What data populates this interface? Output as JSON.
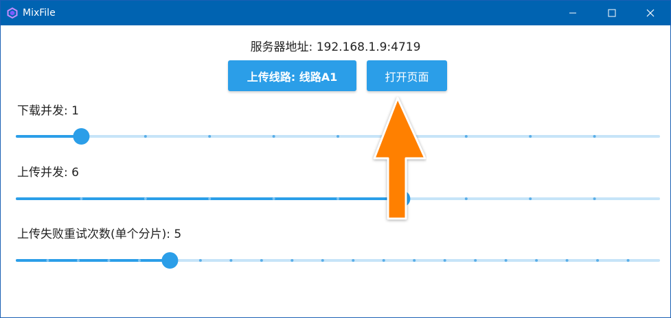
{
  "window": {
    "title": "MixFile",
    "buttons": [
      "minimize",
      "maximize",
      "close"
    ]
  },
  "server": {
    "label": "服务器地址: 192.168.1.9:4719"
  },
  "buttons": {
    "upload_line": "上传线路: 线路A1",
    "open_page": "打开页面"
  },
  "sliders": [
    {
      "label": "下载并发: 1",
      "value": 1,
      "min": 0,
      "max": 10
    },
    {
      "label": "上传并发: 6",
      "value": 6,
      "min": 0,
      "max": 10
    },
    {
      "label": "上传失败重试次数(单个分片): 5",
      "value": 5,
      "min": 0,
      "max": 21
    }
  ],
  "colors": {
    "titlebar": "#0063b1",
    "accent": "#2b9ee8",
    "track": "#c6e4f8",
    "arrow": "#ff8000"
  },
  "annotation": {
    "type": "arrow",
    "direction": "up",
    "points_to": "open-page-button"
  }
}
